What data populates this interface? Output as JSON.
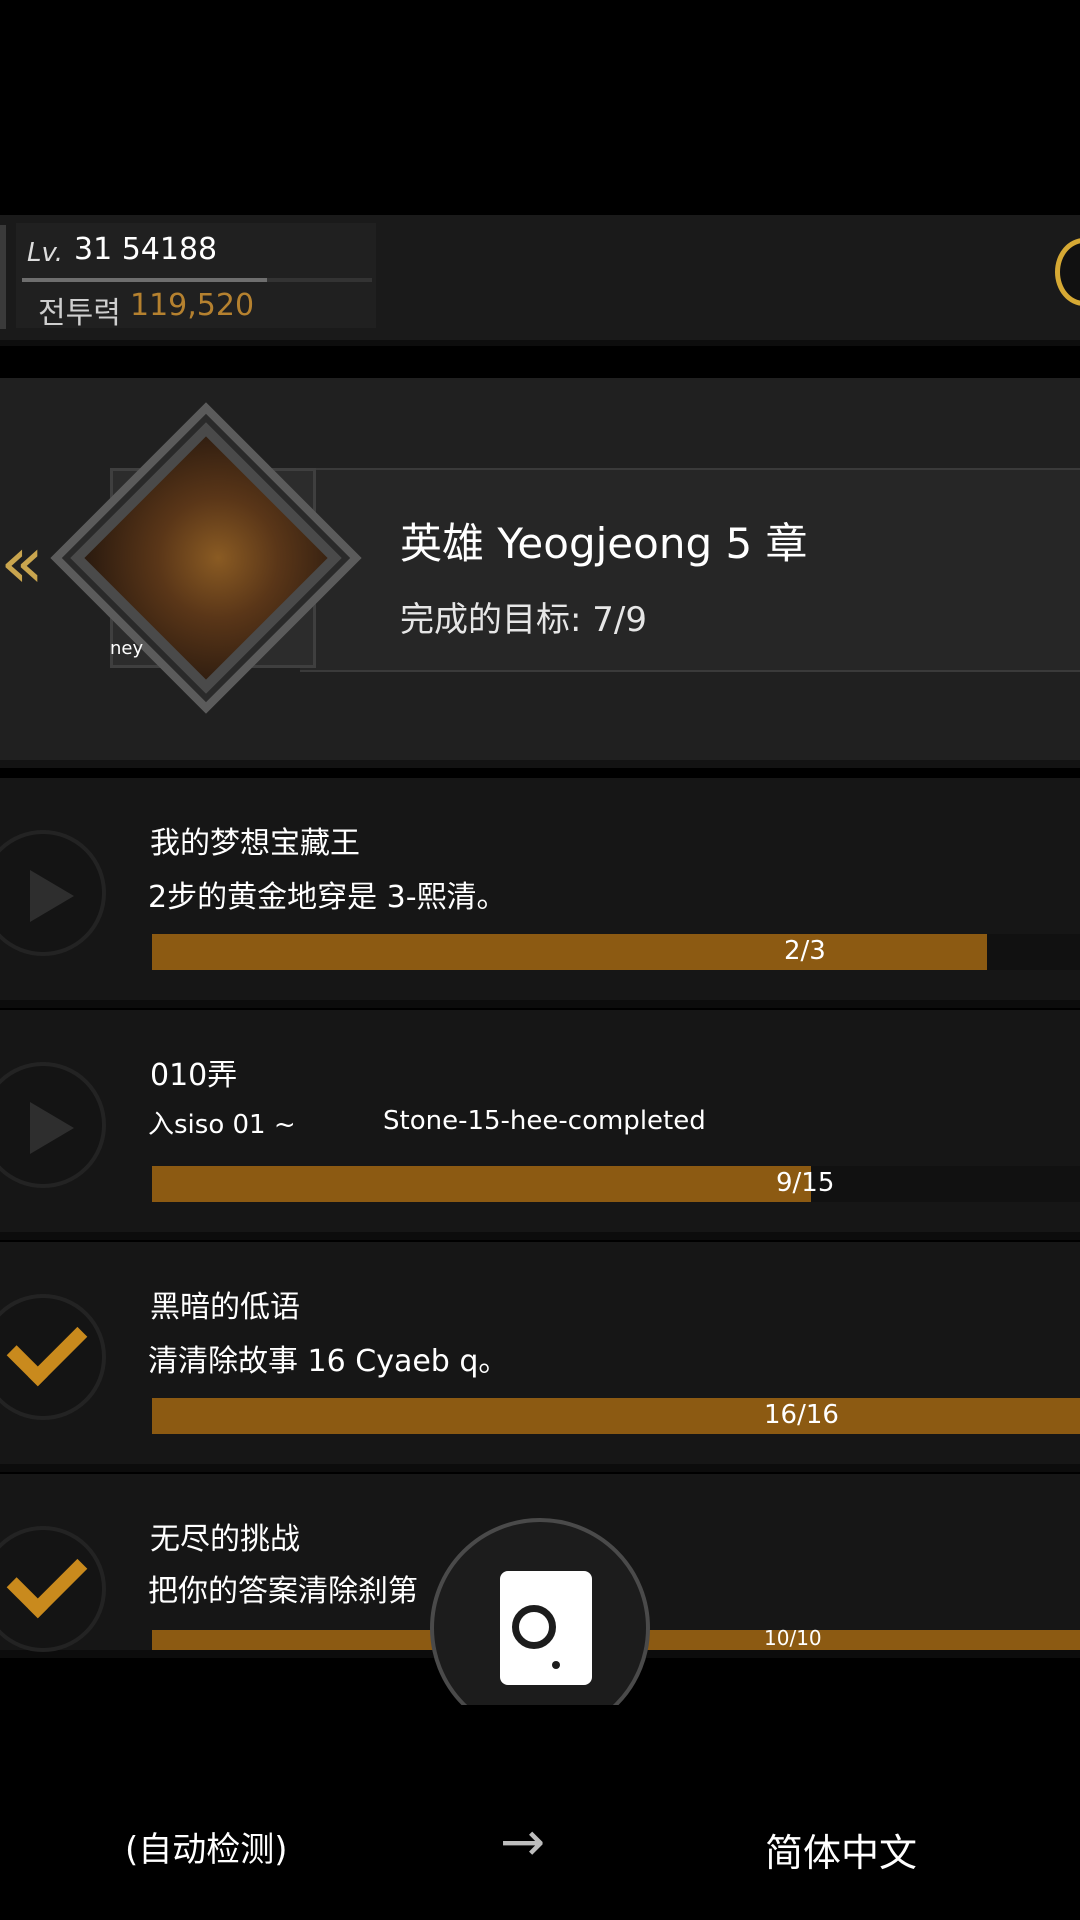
{
  "header": {
    "level_label": "Lv.",
    "level_value": "31 54188",
    "level_progress": 0.7,
    "power_label": "전투력",
    "power_value": "119,520",
    "coin_icon": "coin-icon"
  },
  "chapter": {
    "back_icon": "double-chevron-left-icon",
    "title": "英雄 Yeogjeong 5 章",
    "progress": "完成的目标: 7/9",
    "emblem_caption": "ney"
  },
  "missions": [
    {
      "state": "play",
      "title": "我的梦想宝藏王",
      "desc": "2步的黄金地穿是 3-熙清。",
      "extra": "",
      "progress_text": "2/3",
      "progress": 0.9
    },
    {
      "state": "play",
      "title": "010弄",
      "desc": "入siso 01 ~",
      "extra": "Stone-15-hee-completed",
      "progress_text": "9/15",
      "progress": 0.71
    },
    {
      "state": "done",
      "title": "黑暗的低语",
      "desc": "清清除故事 16 Cyaeb q。",
      "extra": "",
      "progress_text": "16/16",
      "progress": 1.0
    },
    {
      "state": "done",
      "title": "无尽的挑战",
      "desc": "把你的答案清除刹第",
      "extra": "",
      "progress_text": "10/10",
      "progress": 1.0
    }
  ],
  "camera": {
    "icon": "camera-icon"
  },
  "language": {
    "source": "(自动检测)",
    "arrow": "→",
    "target": "简体中文"
  },
  "colors": {
    "accent": "#c98a1d",
    "bar_fill": "#8c5a12",
    "power": "#b5812f",
    "coin": "#d6a934"
  }
}
